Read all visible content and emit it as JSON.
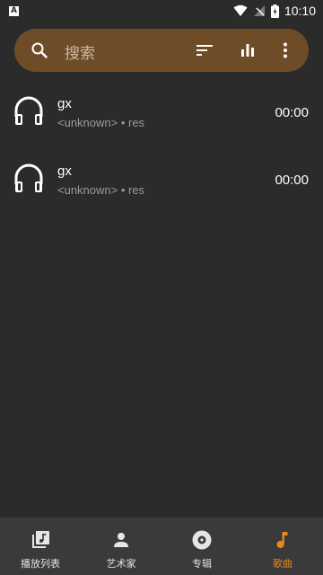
{
  "status_bar": {
    "notification_letter": "A",
    "time": "10:10"
  },
  "search": {
    "placeholder": "搜索",
    "icons": [
      "search-icon",
      "sort-icon",
      "equalizer-icon",
      "more-vert-icon"
    ]
  },
  "songs": [
    {
      "title": "gx",
      "subtitle": "<unknown> • res",
      "duration": "00:00",
      "icon": "headphones-icon"
    },
    {
      "title": "gx",
      "subtitle": "<unknown> • res",
      "duration": "00:00",
      "icon": "headphones-icon"
    }
  ],
  "bottom_nav": {
    "items": [
      {
        "label": "播放列表",
        "icon": "playlist-icon"
      },
      {
        "label": "艺术家",
        "icon": "person-icon"
      },
      {
        "label": "专辑",
        "icon": "album-icon"
      },
      {
        "label": "歌曲",
        "icon": "music-note-icon",
        "active": true
      }
    ]
  },
  "colors": {
    "background": "#2b2b2b",
    "search_bar": "#6e4c28",
    "accent": "#e88a1a",
    "nav_background": "#3a3a3a"
  }
}
